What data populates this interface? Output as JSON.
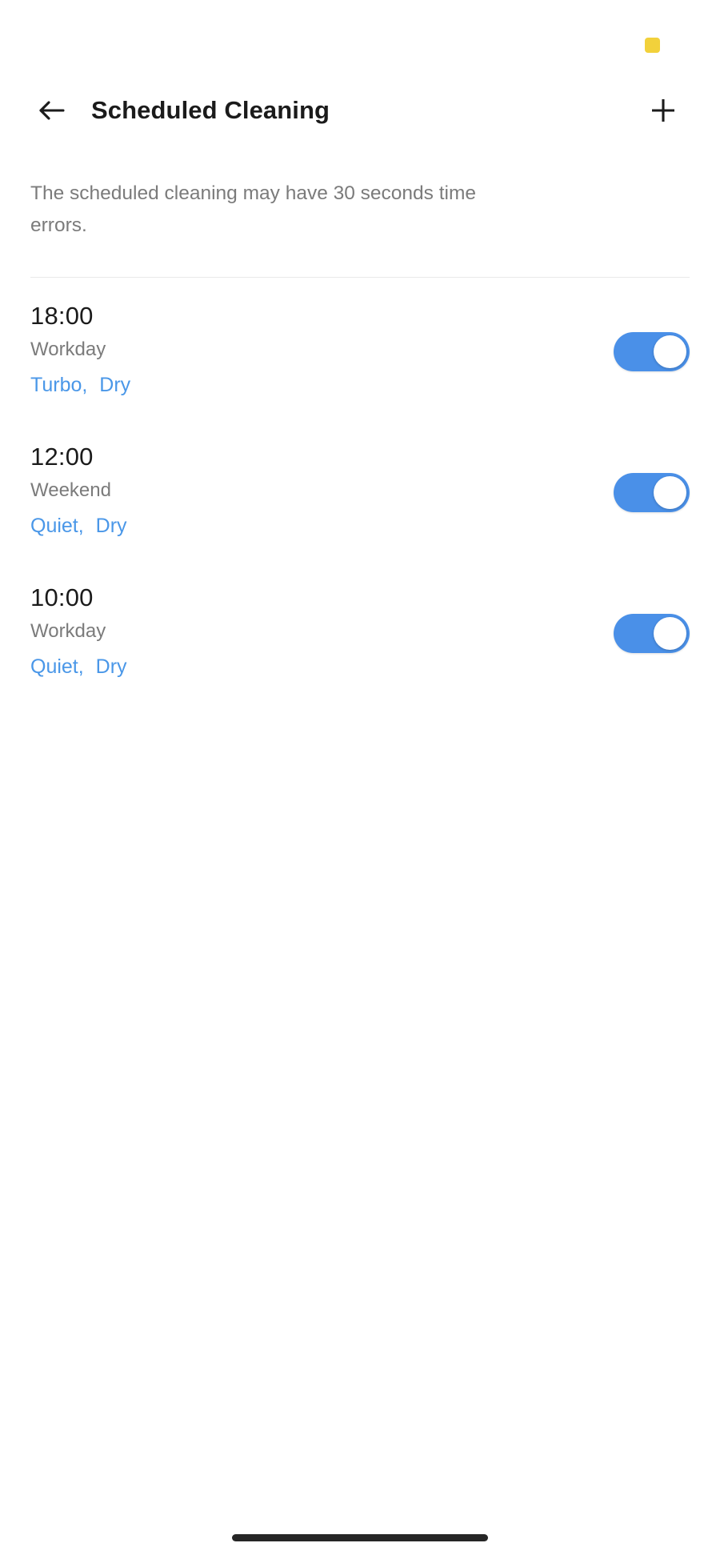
{
  "status_bar": {
    "badge_icon": "yellow-square-badge",
    "badge_color": "#F2D13B"
  },
  "app_bar": {
    "back_icon": "arrow-left-icon",
    "title": "Scheduled Cleaning",
    "add_icon": "plus-icon"
  },
  "description": "The scheduled cleaning may have 30 seconds time errors.",
  "schedules": [
    {
      "time": "18:00",
      "repeat": "Workday",
      "mode_primary": "Turbo,",
      "mode_secondary": "Dry",
      "enabled": true
    },
    {
      "time": "12:00",
      "repeat": "Weekend",
      "mode_primary": "Quiet,",
      "mode_secondary": "Dry",
      "enabled": true
    },
    {
      "time": "10:00",
      "repeat": "Workday",
      "mode_primary": "Quiet,",
      "mode_secondary": "Dry",
      "enabled": true
    }
  ],
  "colors": {
    "accent_blue": "#4A90E8",
    "mode_link_blue": "#4A97E8",
    "text_primary": "#1B1B1B",
    "text_secondary": "#7B7B7B",
    "divider": "#E9E9E9",
    "home_indicator": "#262626"
  },
  "home_indicator": {
    "label": "home-indicator"
  }
}
